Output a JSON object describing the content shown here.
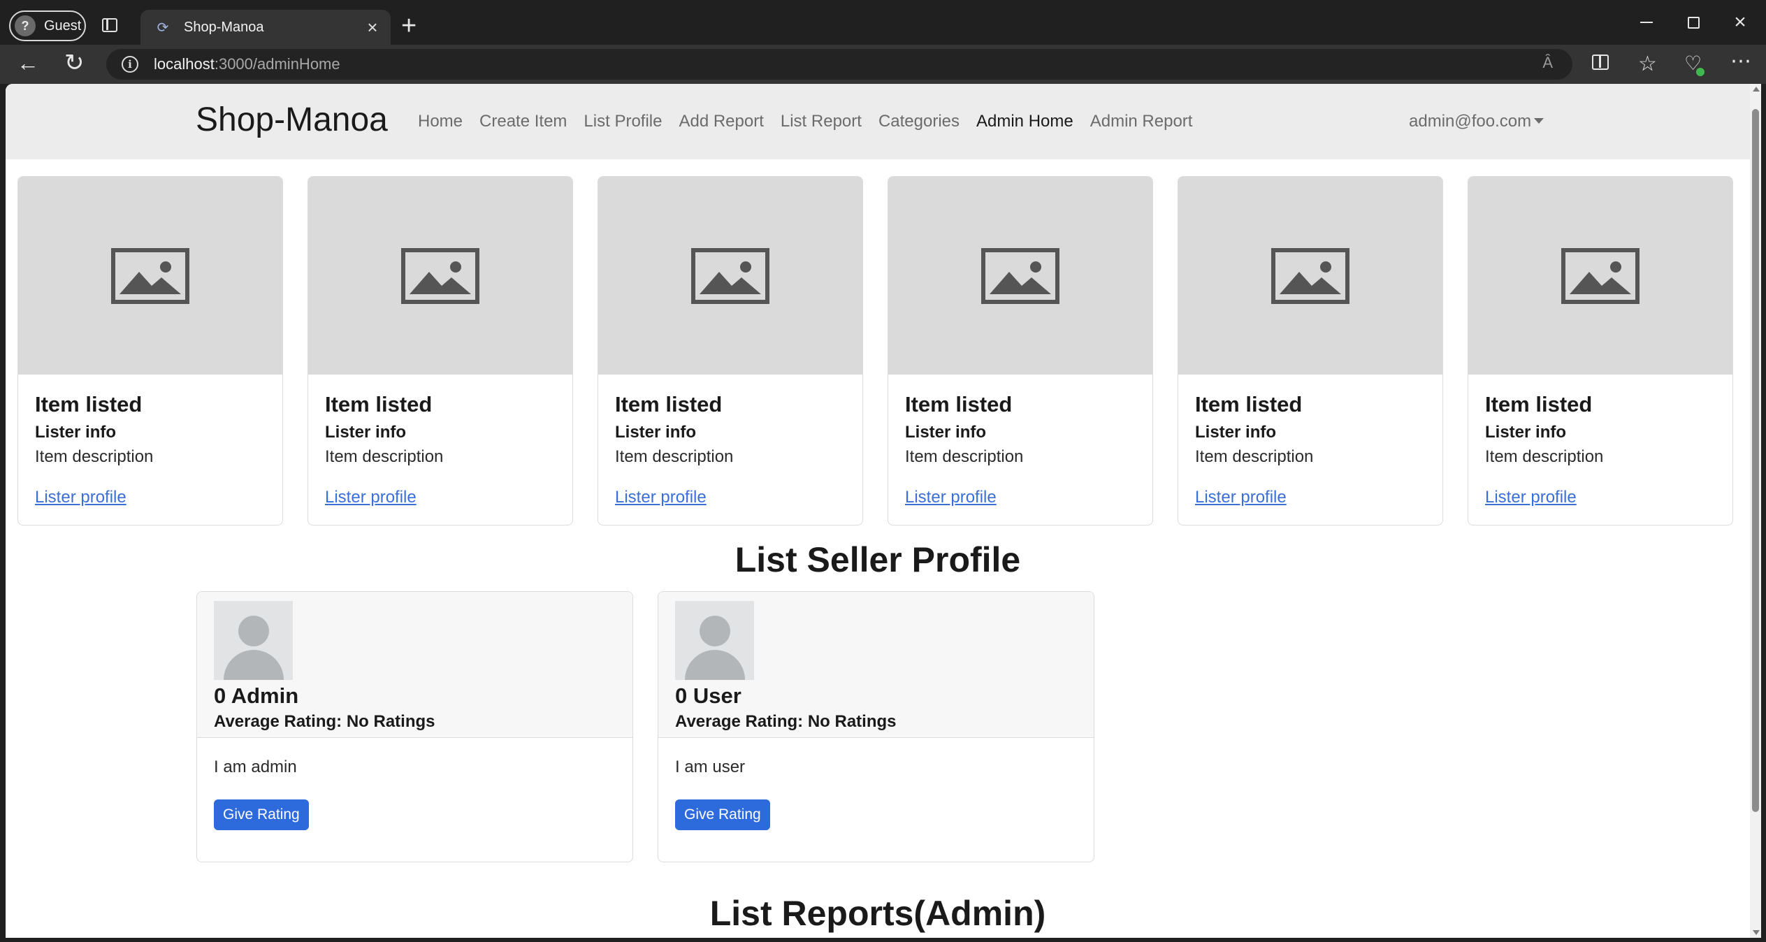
{
  "browser": {
    "profile_label": "Guest",
    "tab_title": "Shop-Manoa",
    "new_tab_glyph": "+",
    "close_glyph": "×",
    "url_host": "localhost",
    "url_path": ":3000/adminHome",
    "read_aloud_glyph": "Ȃ"
  },
  "site": {
    "brand": "Shop-Manoa",
    "nav": [
      {
        "label": "Home"
      },
      {
        "label": "Create Item"
      },
      {
        "label": "List Profile"
      },
      {
        "label": "Add Report"
      },
      {
        "label": "List Report"
      },
      {
        "label": "Categories"
      },
      {
        "label": "Admin Home",
        "active": true
      },
      {
        "label": "Admin Report"
      }
    ],
    "user_email": "admin@foo.com"
  },
  "items": [
    {
      "title": "Item listed",
      "lister": "Lister info",
      "description": "Item description",
      "link": "Lister profile"
    },
    {
      "title": "Item listed",
      "lister": "Lister info",
      "description": "Item description",
      "link": "Lister profile"
    },
    {
      "title": "Item listed",
      "lister": "Lister info",
      "description": "Item description",
      "link": "Lister profile"
    },
    {
      "title": "Item listed",
      "lister": "Lister info",
      "description": "Item description",
      "link": "Lister profile"
    },
    {
      "title": "Item listed",
      "lister": "Lister info",
      "description": "Item description",
      "link": "Lister profile"
    },
    {
      "title": "Item listed",
      "lister": "Lister info",
      "description": "Item description",
      "link": "Lister profile"
    }
  ],
  "sections": {
    "seller_title": "List Seller Profile",
    "reports_title": "List Reports(Admin)"
  },
  "profiles": [
    {
      "name": "0 Admin",
      "rating": "Average Rating: No Ratings",
      "bio": "I am admin",
      "button": "Give Rating"
    },
    {
      "name": "0 User",
      "rating": "Average Rating: No Ratings",
      "bio": "I am user",
      "button": "Give Rating"
    }
  ],
  "colors": {
    "link": "#3a6fd8",
    "button": "#2d6bdd",
    "navbar_bg": "#ececec",
    "placeholder_bg": "#dadada"
  }
}
